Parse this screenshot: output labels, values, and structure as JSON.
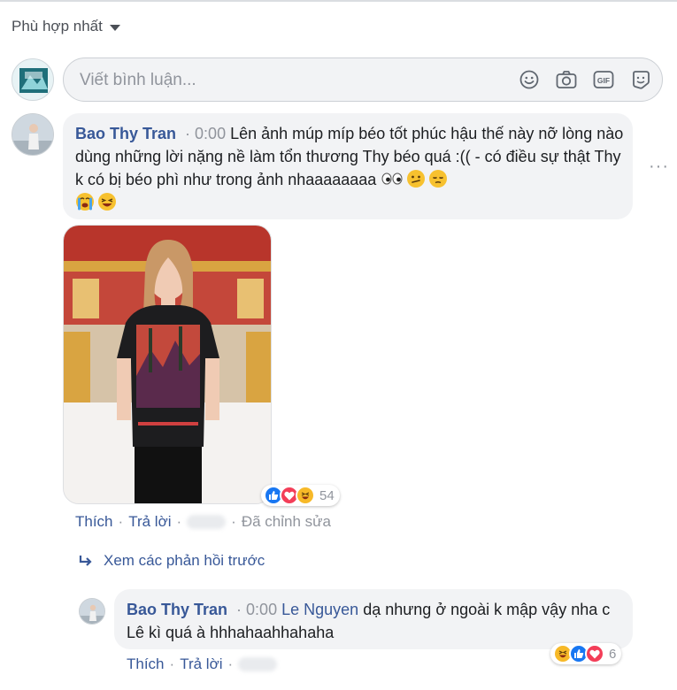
{
  "sort": {
    "label": "Phù hợp nhất"
  },
  "composer": {
    "placeholder": "Viết bình luận..."
  },
  "comment": {
    "author": "Bao Thy Tran",
    "time": "0:00",
    "text": "Lên ảnh múp míp béo tốt phúc hậu thế này nỡ lòng nào dùng những lời nặng nề làm tổn thương Thy béo quá :(( - có điều sự thật Thy k có bị béo phì như trong ảnh nhaaaaaaaa",
    "reaction_count": "54",
    "actions": {
      "like": "Thích",
      "reply": "Trả lời",
      "edited": "Đã chỉnh sửa"
    }
  },
  "previous_replies": "Xem các phản hồi trước",
  "reply": {
    "author": "Bao Thy Tran",
    "time": "0:00",
    "mention": "Le Nguyen",
    "text": "dạ nhưng ở ngoài k mập vậy nha c Lê kì quá à hhhahaahhahaha",
    "reaction_count": "6",
    "actions": {
      "like": "Thích",
      "reply": "Trả lời"
    }
  },
  "colors": {
    "link": "#385898",
    "meta": "#90949c",
    "bubble": "#f2f3f5",
    "like_blue": "#1877f2",
    "love_red": "#f33e58",
    "haha_yellow": "#f7b928"
  },
  "icons": [
    "chevron-down-icon",
    "emoji-icon",
    "camera-icon",
    "gif-icon",
    "sticker-icon",
    "reply-arrow-icon",
    "like-reaction-icon",
    "love-reaction-icon",
    "haha-reaction-icon"
  ]
}
